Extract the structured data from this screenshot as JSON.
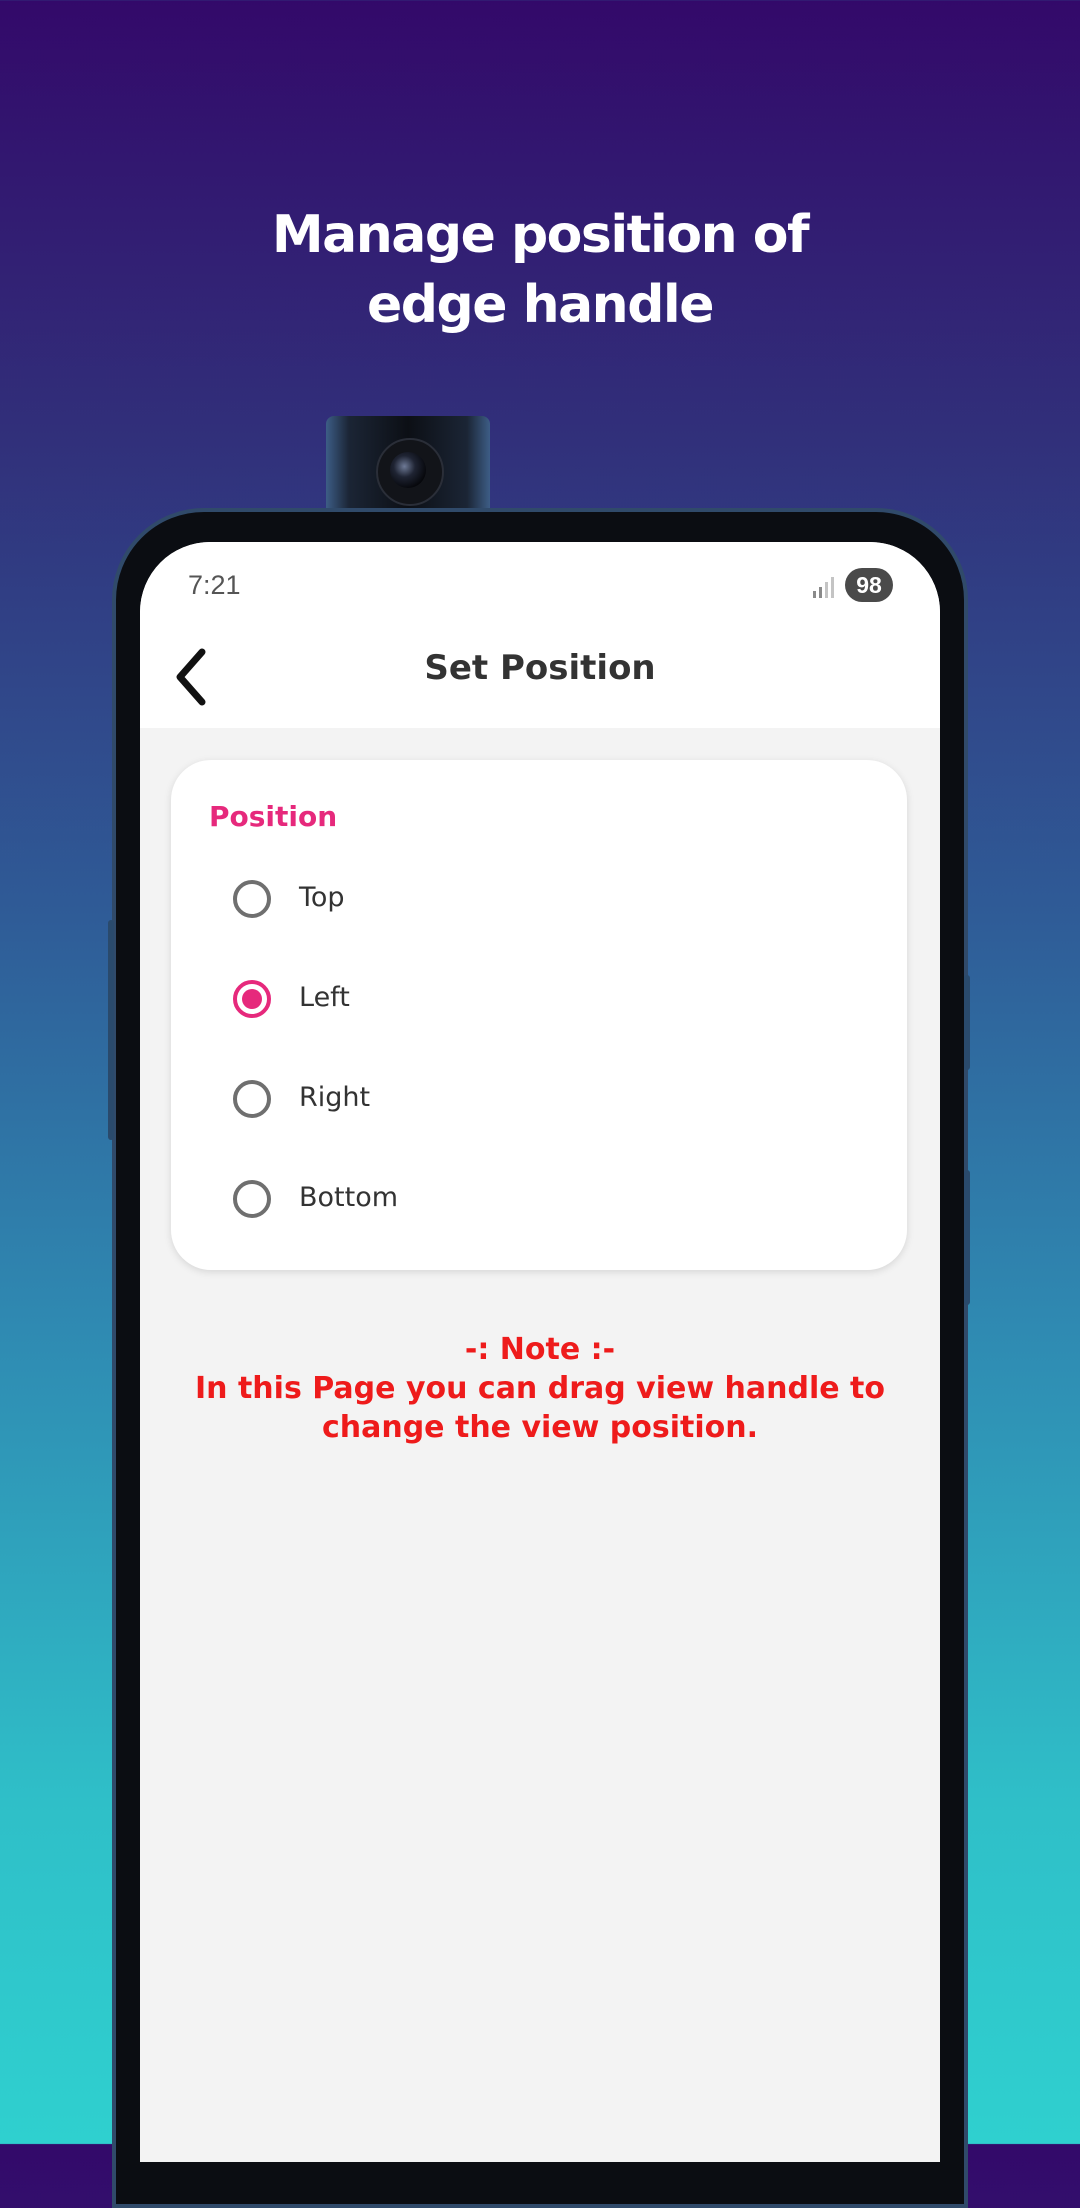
{
  "promo": {
    "headline_line1": "Manage position of",
    "headline_line2": "edge handle"
  },
  "status_bar": {
    "time": "7:21",
    "battery": "98"
  },
  "app_bar": {
    "title": "Set Position"
  },
  "position_card": {
    "title": "Position",
    "options": [
      {
        "label": "Top",
        "selected": false
      },
      {
        "label": "Left",
        "selected": true
      },
      {
        "label": "Right",
        "selected": false
      },
      {
        "label": "Bottom",
        "selected": false
      }
    ]
  },
  "note": {
    "heading": "-: Note :-",
    "line1": "In this Page you can drag view handle to",
    "line2": "change the view position."
  },
  "colors": {
    "accent": "#e6297c",
    "note_text": "#ee1b1b"
  }
}
